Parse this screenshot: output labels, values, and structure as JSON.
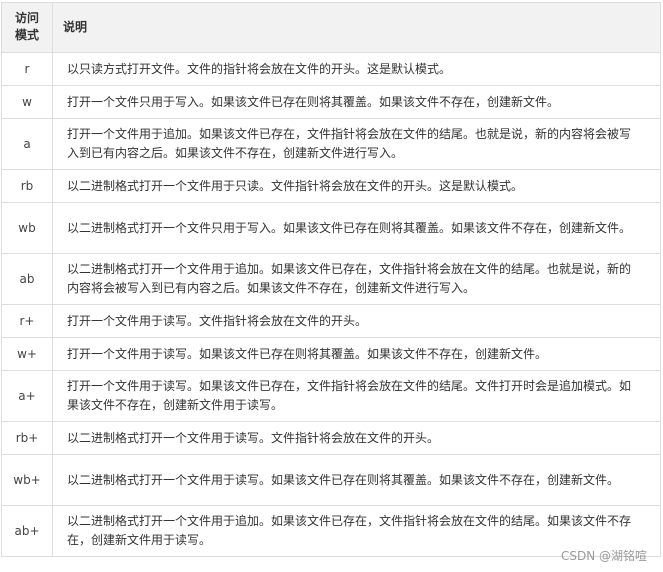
{
  "table": {
    "header": {
      "mode": "访问\n模式",
      "description": "说明"
    },
    "rows": [
      {
        "mode": "r",
        "description": "以只读方式打开文件。文件的指针将会放在文件的开头。这是默认模式。"
      },
      {
        "mode": "w",
        "description": "打开一个文件只用于写入。如果该文件已存在则将其覆盖。如果该文件不存在，创建新文件。"
      },
      {
        "mode": "a",
        "description": "打开一个文件用于追加。如果该文件已存在，文件指针将会放在文件的结尾。也就是说，新的内容将会被写入到已有内容之后。如果该文件不存在，创建新文件进行写入。"
      },
      {
        "mode": "rb",
        "description": "以二进制格式打开一个文件用于只读。文件指针将会放在文件的开头。这是默认模式。"
      },
      {
        "mode": "wb",
        "description": "以二进制格式打开一个文件只用于写入。如果该文件已存在则将其覆盖。如果该文件不存在，创建新文件。"
      },
      {
        "mode": "ab",
        "description": "以二进制格式打开一个文件用于追加。如果该文件已存在，文件指针将会放在文件的结尾。也就是说，新的内容将会被写入到已有内容之后。如果该文件不存在，创建新文件进行写入。"
      },
      {
        "mode": "r+",
        "description": "打开一个文件用于读写。文件指针将会放在文件的开头。"
      },
      {
        "mode": "w+",
        "description": "打开一个文件用于读写。如果该文件已存在则将其覆盖。如果该文件不存在，创建新文件。"
      },
      {
        "mode": "a+",
        "description": "打开一个文件用于读写。如果该文件已存在，文件指针将会放在文件的结尾。文件打开时会是追加模式。如果该文件不存在，创建新文件用于读写。"
      },
      {
        "mode": "rb+",
        "description": "以二进制格式打开一个文件用于读写。文件指针将会放在文件的开头。"
      },
      {
        "mode": "wb+",
        "description": "以二进制格式打开一个文件用于读写。如果该文件已存在则将其覆盖。如果该文件不存在，创建新文件。"
      },
      {
        "mode": "ab+",
        "description": "以二进制格式打开一个文件用于追加。如果该文件已存在，文件指针将会放在文件的结尾。如果该文件不存在，创建新文件用于读写。"
      }
    ]
  },
  "watermark": "CSDN @湖铭喧"
}
